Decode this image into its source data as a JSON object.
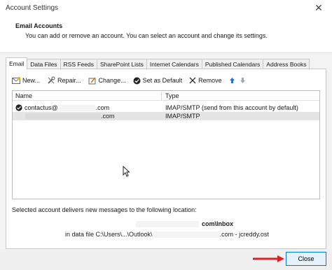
{
  "window": {
    "title": "Account Settings",
    "close_glyph": "✕"
  },
  "header": {
    "title": "Email Accounts",
    "description": "You can add or remove an account. You can select an account and change its settings."
  },
  "tabs": [
    {
      "label": "Email",
      "active": true
    },
    {
      "label": "Data Files"
    },
    {
      "label": "RSS Feeds"
    },
    {
      "label": "SharePoint Lists"
    },
    {
      "label": "Internet Calendars"
    },
    {
      "label": "Published Calendars"
    },
    {
      "label": "Address Books"
    }
  ],
  "toolbar": {
    "new_label": "New...",
    "repair_label": "Repair...",
    "change_label": "Change...",
    "default_label": "Set as Default",
    "remove_label": "Remove"
  },
  "list": {
    "col_name": "Name",
    "col_type": "Type",
    "rows": [
      {
        "name_prefix": "contactus@",
        "name_suffix": ".com",
        "type": "IMAP/SMTP (send from this account by default)",
        "default": true
      },
      {
        "name_prefix": "",
        "name_suffix": ".com",
        "type": "IMAP/SMTP",
        "default": false
      }
    ]
  },
  "location": {
    "label": "Selected account delivers new messages to the following location:",
    "folder": "com\\Inbox",
    "file_prefix": "in data file C:\\Users\\...\\Outlook\\",
    "file_suffix": ".com - jcreddy.ost"
  },
  "footer": {
    "close_label": "Close"
  },
  "colors": {
    "accent": "#0078d7",
    "arrow": "#d9232a",
    "selection": "#e5e5e5"
  }
}
